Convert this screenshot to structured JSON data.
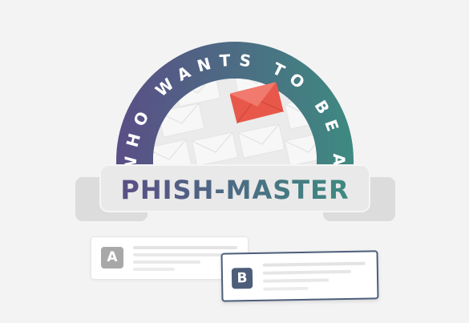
{
  "banner": {
    "arc_text": "WHO WANTS TO BE A",
    "title": "PHISH-MASTER"
  },
  "options": [
    {
      "letter": "A"
    },
    {
      "letter": "B"
    }
  ],
  "colors": {
    "background": "#f3f3f3",
    "arc_start": "#5a4e86",
    "arc_end": "#3e8a81",
    "envelope_red": "#e8584a",
    "plaque": "#e9e9e9",
    "ribbon_tab": "#dcdcdc",
    "option_a_badge": "#a8a8a8",
    "option_b_badge": "#4d5e7a",
    "option_b_border": "#4d5e7a"
  },
  "icons": {
    "emblem_envelopes": "envelope-icon",
    "highlighted_envelope": "red-envelope-icon"
  }
}
